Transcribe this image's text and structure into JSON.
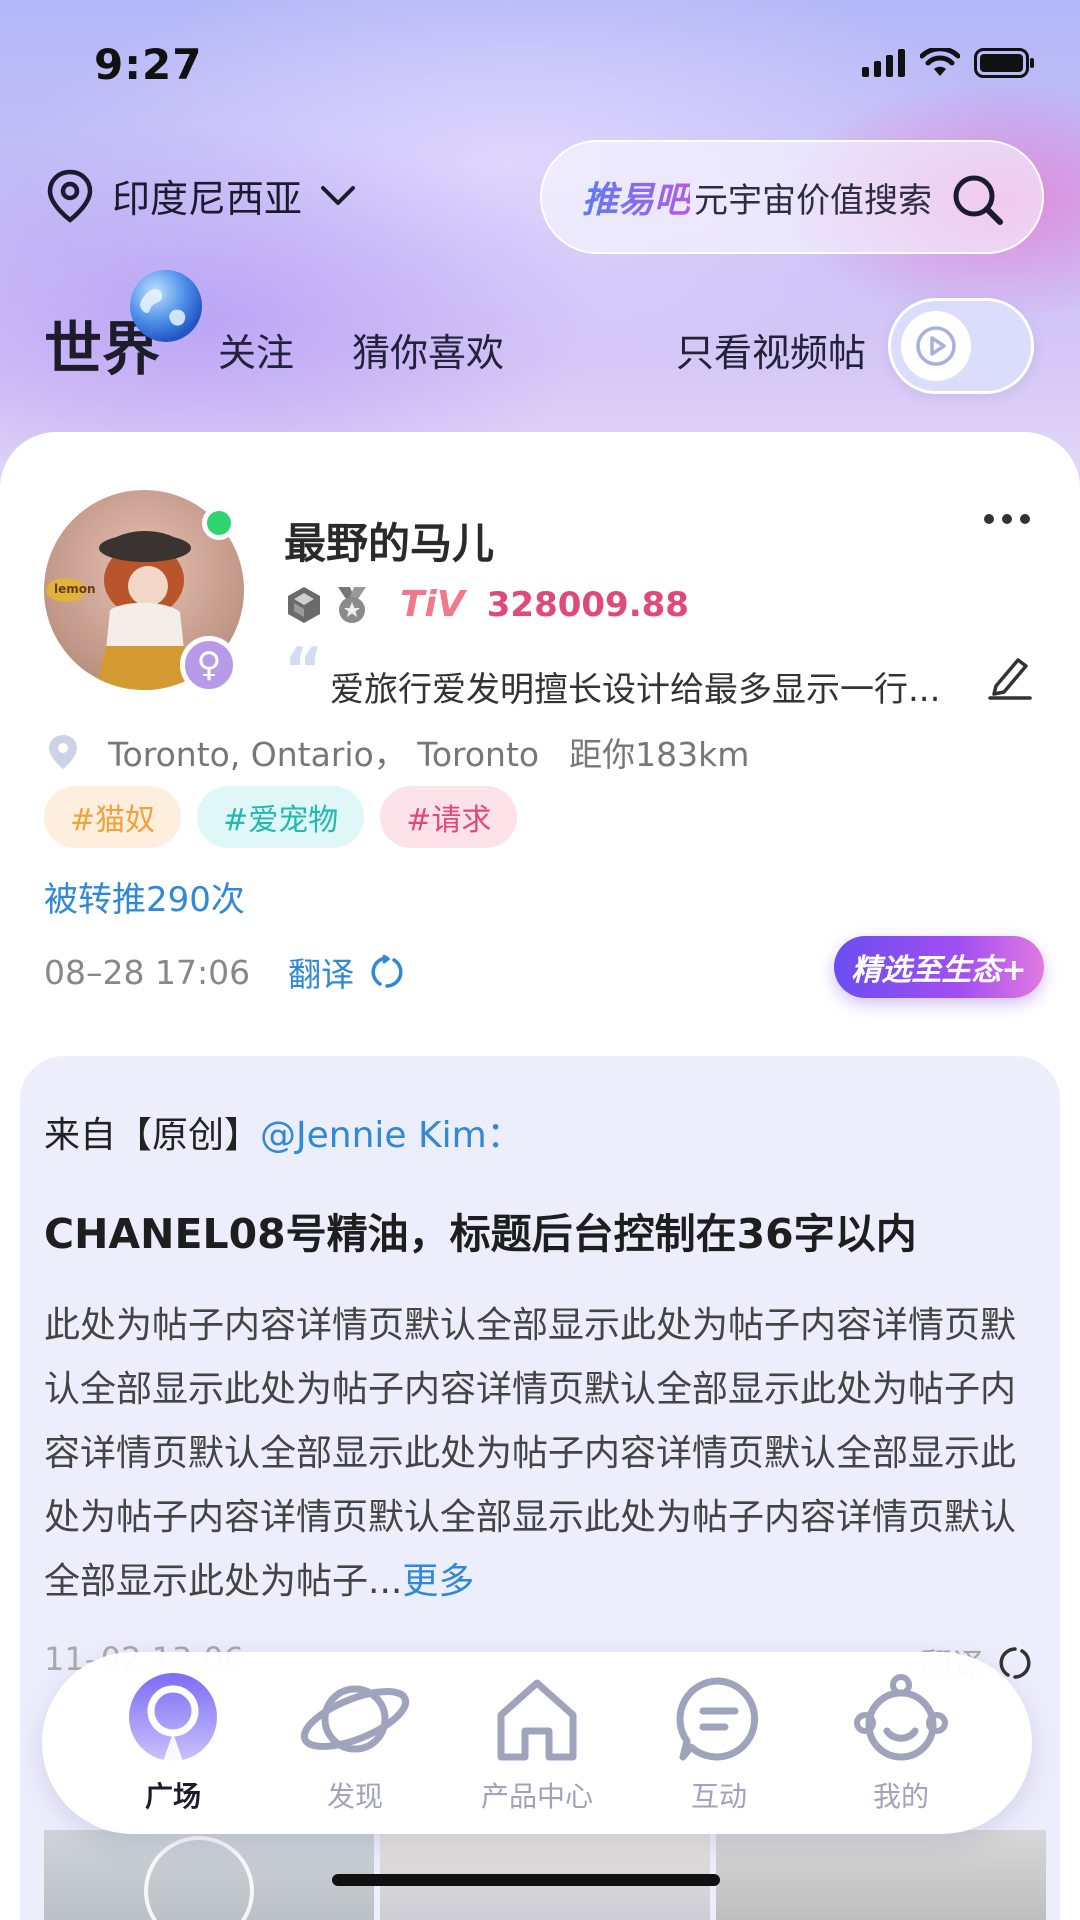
{
  "status": {
    "time": "9:27"
  },
  "location": {
    "label": "印度尼西亚"
  },
  "search": {
    "brand": "推易吧",
    "placeholder": "元宇宙价值搜索"
  },
  "tabs": {
    "world": "世界",
    "follow": "关注",
    "guess": "猜你喜欢",
    "video_only": "只看视频帖"
  },
  "post": {
    "username": "最野的马儿",
    "avatar_text": "lemon",
    "tiv_label": "TiV",
    "tiv_value": "328009.88",
    "bio": "爱旅行爱发明擅长设计给最多显示一行...",
    "location": "Toronto, Ontario，  Toronto",
    "distance": "距你183km",
    "tags": [
      {
        "label": "#猫奴",
        "color": "#f0a23c",
        "bg": "#fdeedd"
      },
      {
        "label": "#爱宠物",
        "color": "#1fb8b2",
        "bg": "#dff7f6"
      },
      {
        "label": "#请求",
        "color": "#e0497a",
        "bg": "#fde2ea"
      }
    ],
    "repost_count": "被转推290次",
    "time": "08–28 17:06",
    "translate": "翻译",
    "featured_button": "精选至生态+"
  },
  "forwarded": {
    "source_prefix": "来自【原创】",
    "mention": "@Jennie Kim：",
    "title": "CHANEL08号精油，标题后台控制在36字以内",
    "body": "此处为帖子内容详情页默认全部显示此处为帖子内容详情页默认全部显示此处为帖子内容详情页默认全部显示此处为帖子内容详情页默认全部显示此处为帖子内容详情页默认全部显示此处为帖子内容详情页默认全部显示此处为帖子内容详情页默认全部显示此处为帖子...",
    "more": "更多",
    "time": "11–02  13:06",
    "translate": "翻译"
  },
  "nav": [
    {
      "label": "广场",
      "icon": "plaza-icon",
      "active": true
    },
    {
      "label": "发现",
      "icon": "planet-icon",
      "active": false
    },
    {
      "label": "产品中心",
      "icon": "home-icon",
      "active": false
    },
    {
      "label": "互动",
      "icon": "chat-icon",
      "active": false
    },
    {
      "label": "我的",
      "icon": "baby-face-icon",
      "active": false
    }
  ],
  "colors": {
    "accent": "#2f88d8",
    "brand_purple": "#8a5cf0",
    "tiv": "#e0497a"
  }
}
